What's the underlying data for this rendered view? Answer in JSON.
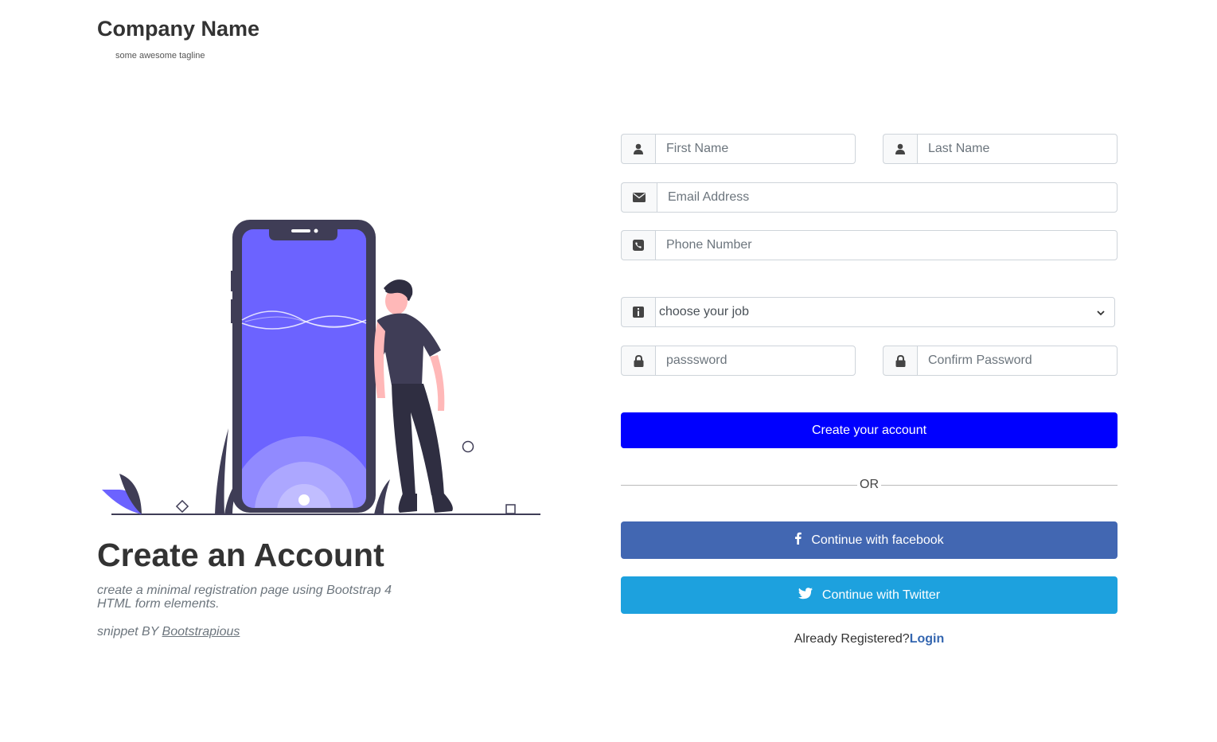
{
  "brand": {
    "name": "Company Name",
    "tagline": "some awesome tagline"
  },
  "hero": {
    "title": "Create an Account",
    "lead": "create a minimal registration page using Bootstrap 4 HTML form elements.",
    "credit_prefix": "snippet BY ",
    "credit_link": "Bootstrapious"
  },
  "form": {
    "first_name_placeholder": "First Name",
    "last_name_placeholder": "Last Name",
    "email_placeholder": "Email Address",
    "phone_placeholder": "Phone Number",
    "job_selected": "choose your job",
    "password_placeholder": "passsword",
    "confirm_password_placeholder": "Confirm Password",
    "submit_label": "Create your account",
    "divider_label": "OR",
    "facebook_label": "Continue with facebook",
    "twitter_label": "Continue with Twitter",
    "already_registered": "Already Registered?",
    "login_label": "Login"
  },
  "colors": {
    "primary": "#0000ff",
    "facebook": "#4267b2",
    "twitter": "#1da1de",
    "illustration_accent": "#6c63ff",
    "illustration_dark": "#3f3d56"
  }
}
